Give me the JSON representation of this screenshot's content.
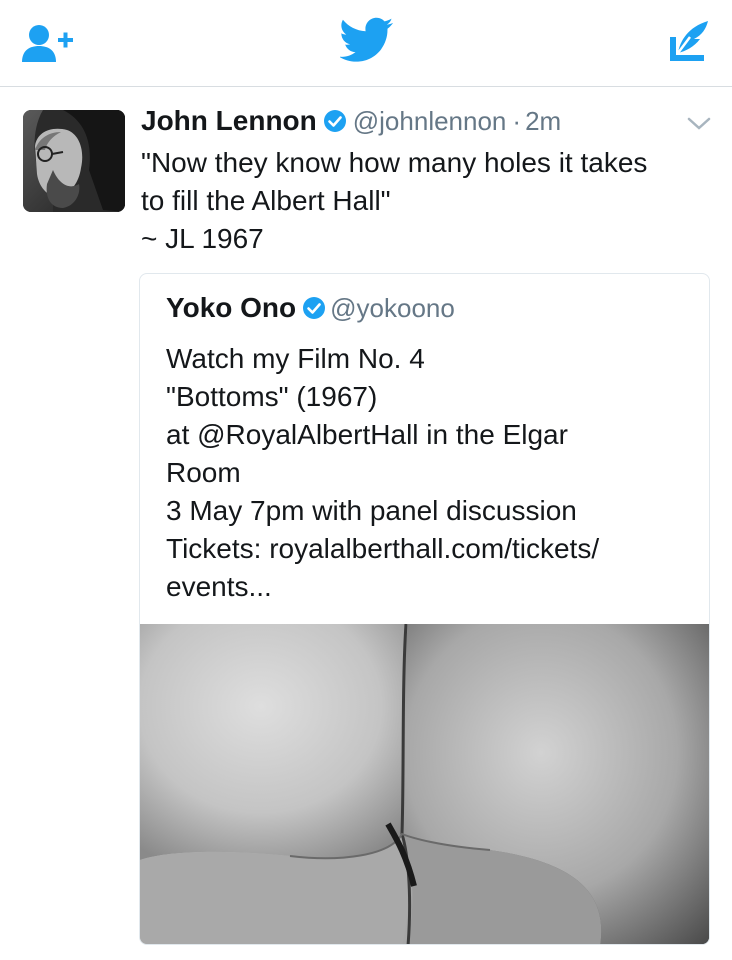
{
  "topbar": {
    "add_user_icon": "add-user-icon",
    "logo_icon": "twitter-bird-icon",
    "compose_icon": "compose-tweet-icon",
    "accent_color": "#1da1f2"
  },
  "tweet": {
    "author_name": "John Lennon",
    "author_handle": "@johnlennon",
    "separator": "·",
    "time": "2m",
    "text_lines": [
      "\"Now they know how many holes it takes",
      "to fill the Albert Hall\"",
      "~ JL 1967"
    ],
    "quoted": {
      "author_name": "Yoko Ono",
      "author_handle": "@yokoono",
      "text_lines": [
        "Watch my Film No. 4",
        "\"Bottoms\" (1967)",
        "at @RoyalAlbertHall in the Elgar",
        "Room",
        "3 May 7pm with panel discussion",
        "Tickets: royalalberthall.com/tickets/",
        "events..."
      ]
    }
  }
}
